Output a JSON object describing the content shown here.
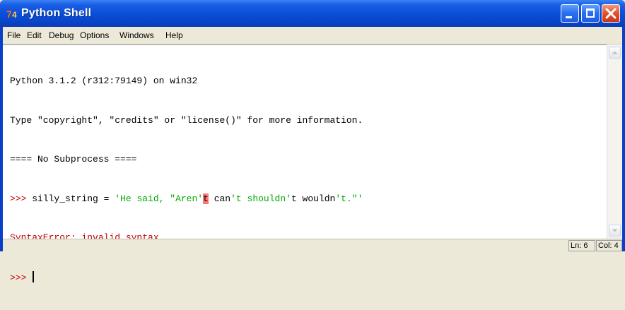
{
  "window": {
    "title": "Python Shell",
    "icon": "python-idle-icon"
  },
  "menu": {
    "items": [
      "File",
      "Edit",
      "Debug",
      "Options",
      "Windows",
      "Help"
    ]
  },
  "shell": {
    "line1": "Python 3.1.2 (r312:79149) on win32",
    "line2": "Type \"copyright\", \"credits\" or \"license()\" for more information.",
    "line3": "==== No Subprocess ====",
    "prompt": ">>>",
    "code_pre": "silly_string = ",
    "str1": "'He said, \"Aren'",
    "highlight": "t",
    "plain1": " can",
    "str2": "'t shouldn'",
    "plain2": "t wouldn",
    "str3": "'t.\"'",
    "error": "SyntaxError: invalid syntax",
    "prompt2": ">>>"
  },
  "status": {
    "line": "Ln: 6",
    "col": "Col: 4"
  },
  "colors": {
    "prompt": "#c00000",
    "string": "#00aa00",
    "error_highlight": "#ff7777",
    "titlebar": "#0a4fd8"
  }
}
